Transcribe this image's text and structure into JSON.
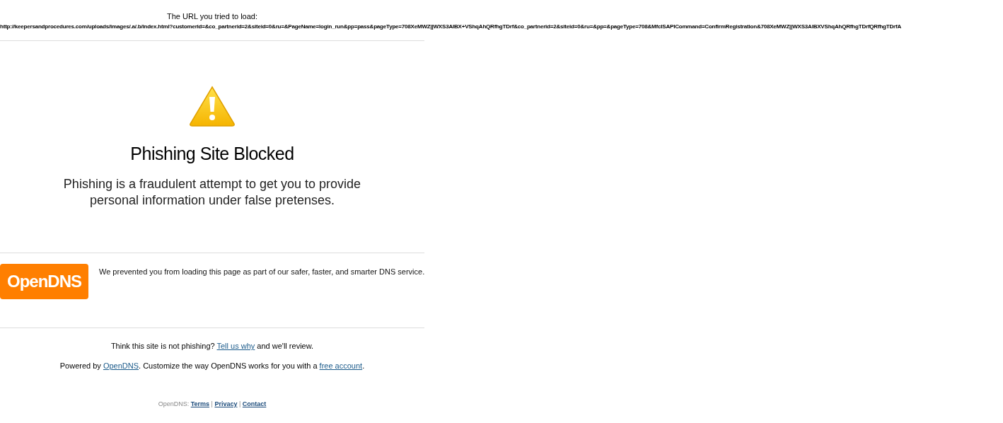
{
  "url_label": "The URL you tried to load:",
  "url": "http://keepersandprocedures.com/uploads/images/.a/.b/index.html?customerid=&co_partnerid=2&siteid=0&ru=&PageName=login_run&pp=pass&pageType=708XeMWZ||WXS3AlBX+VShqAhQRfhgTDrf&co_partnerid=2&siteid=0&ru=&pp=&pageType=708&MfcISAPICommand=ConfirmRegistration&708XeMWZ||WXS3AlBXVShqAhQRfhgTDrfQRfhgTDrfA",
  "warning": {
    "title": "Phishing Site Blocked",
    "description": "Phishing is a fraudulent attempt to get you to provide personal information under false pretenses."
  },
  "opendns": {
    "logo": "OpenDNS",
    "message": "We prevented you from loading this page as part of our safer, faster, and smarter DNS service."
  },
  "review": [
    {
      "kind": "text",
      "text": "Think this site is not phishing?"
    },
    {
      "kind": "link",
      "text": "Tell us why"
    },
    {
      "kind": "text",
      "text": "and we'll review."
    }
  ],
  "powered": [
    {
      "kind": "text",
      "text": "Powered by"
    },
    {
      "kind": "link",
      "text": "OpenDNS"
    },
    {
      "kind": "text",
      "text": ". Customize the way OpenDNS works for you with a"
    },
    {
      "kind": "link",
      "text": "free account"
    },
    {
      "kind": "text",
      "text": "."
    }
  ],
  "footer": [
    {
      "kind": "text",
      "text": "OpenDNS:"
    },
    {
      "kind": "link",
      "text": "Terms"
    },
    {
      "kind": "text",
      "text": "|"
    },
    {
      "kind": "link",
      "text": "Privacy"
    },
    {
      "kind": "text",
      "text": "|"
    },
    {
      "kind": "link",
      "text": "Contact"
    }
  ]
}
